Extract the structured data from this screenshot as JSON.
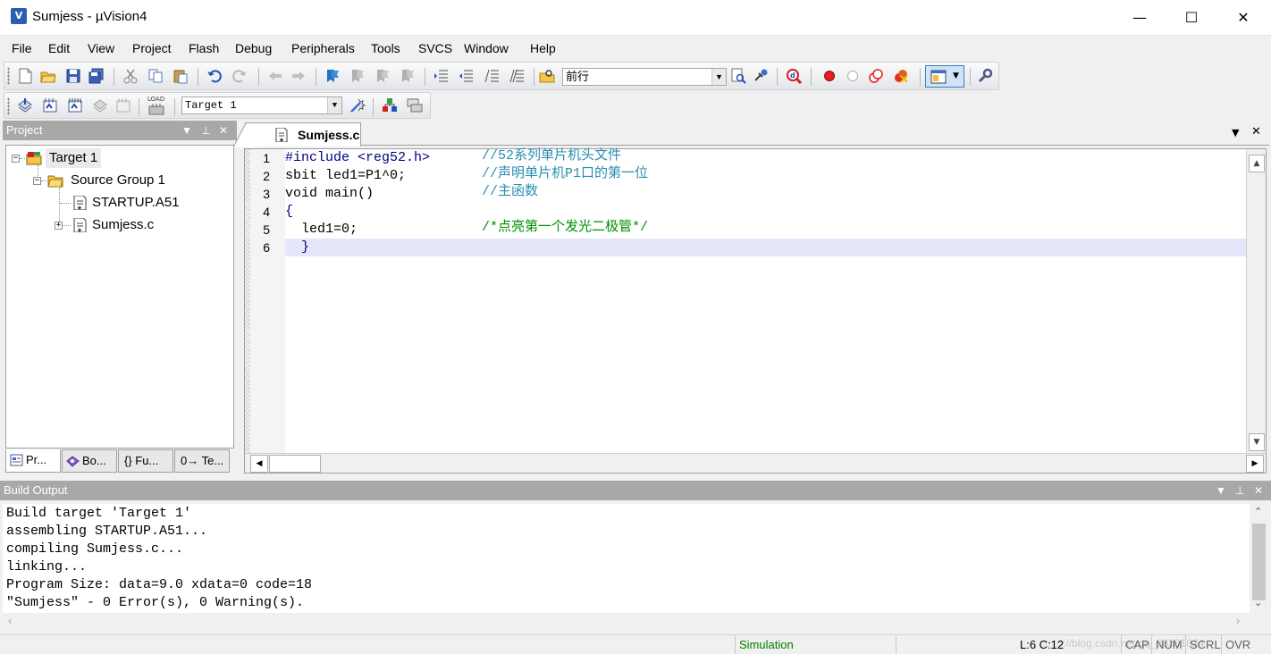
{
  "window": {
    "title": "Sumjess  - µVision4",
    "app_icon_glyph": "V",
    "controls": {
      "minimize": "—",
      "maximize": "☐",
      "close": "✕"
    }
  },
  "menu": [
    {
      "label": "File"
    },
    {
      "label": "Edit"
    },
    {
      "label": "View"
    },
    {
      "label": "Project"
    },
    {
      "label": "Flash"
    },
    {
      "label": "Debug"
    },
    {
      "label": "Peripherals"
    },
    {
      "label": "Tools"
    },
    {
      "label": "SVCS"
    },
    {
      "label": "Window"
    },
    {
      "label": "Help"
    }
  ],
  "toolbar": {
    "find_combo_value": "前行",
    "target_combo_value": "Target 1",
    "load_label": "LOAD"
  },
  "project_panel": {
    "title": "Project",
    "tree": {
      "root": "Target 1",
      "group": "Source Group 1",
      "files": [
        "STARTUP.A51",
        "Sumjess.c"
      ]
    },
    "tabs": [
      "Pr...",
      "Bo...",
      "{} Fu...",
      "0→ Te..."
    ]
  },
  "editor": {
    "tab_label": "Sumjess.c",
    "line_numbers": [
      "1",
      "2",
      "3",
      "4",
      "5",
      "6"
    ],
    "lines": [
      {
        "code": "#include <reg52.h>",
        "comment": "//52系列单片机头文件"
      },
      {
        "code": "sbit led1=P1^0;",
        "comment": "//声明单片机P1口的第一位"
      },
      {
        "code": "void main()",
        "comment": "//主函数"
      },
      {
        "code": "{",
        "comment": ""
      },
      {
        "code": "  led1=0;",
        "comment": "/*点亮第一个发光二极管*/"
      },
      {
        "code": "  }",
        "comment": ""
      }
    ]
  },
  "build_output": {
    "title": "Build Output",
    "lines": [
      "Build target 'Target 1'",
      "assembling STARTUP.A51...",
      "compiling Sumjess.c...",
      "linking...",
      "Program Size: data=9.0 xdata=0 code=18",
      "\"Sumjess\" - 0 Error(s), 0 Warning(s)."
    ]
  },
  "statusbar": {
    "mode": "Simulation",
    "cursor": "L:6 C:12",
    "indicators": [
      "CAP",
      "NUM",
      "SCRL",
      "OVR"
    ],
    "watermark": "https://blog.csdn.net/qq_38351824"
  },
  "colors": {
    "panel_header": "#a8a8a8",
    "current_line": "#e6e6fa",
    "comment_blue": "#2a8db0",
    "comment_green": "#009000",
    "keyword": "#000080",
    "simulation_text": "#008000"
  }
}
